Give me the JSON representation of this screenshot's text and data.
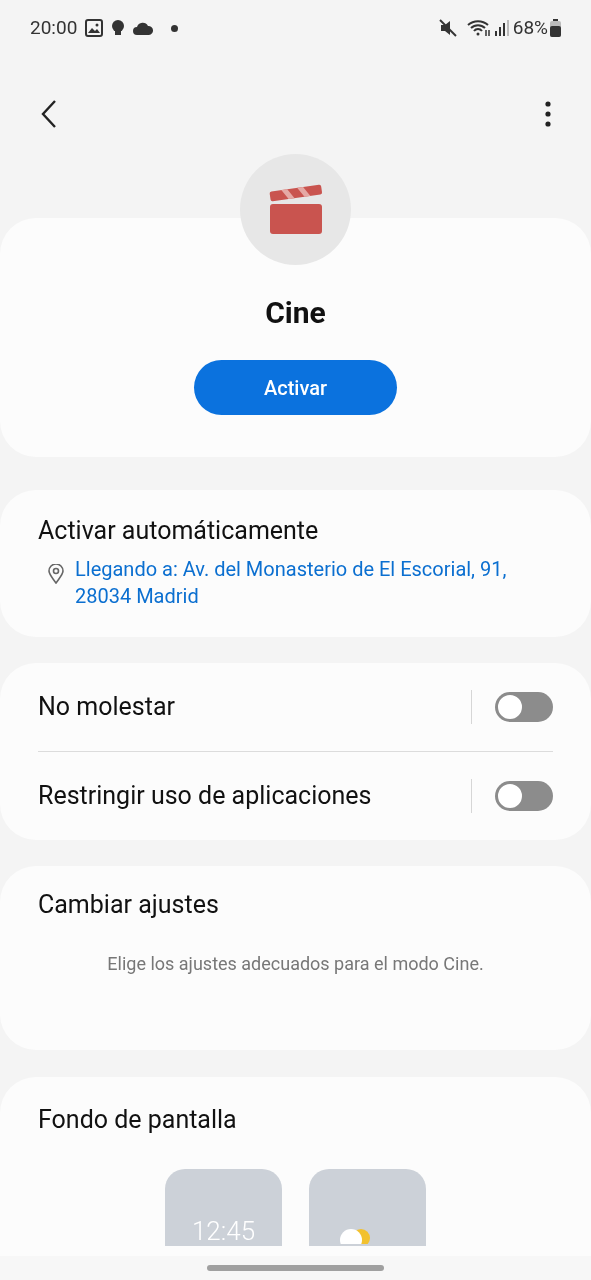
{
  "status_bar": {
    "time": "20:00",
    "battery": "68%"
  },
  "mode": {
    "name": "Cine",
    "button": "Activar"
  },
  "auto_activate": {
    "title": "Activar automáticamente",
    "location": "Llegando a: Av. del Monasterio de El Escorial, 91, 28034 Madrid"
  },
  "toggles": [
    {
      "label": "No molestar",
      "on": false
    },
    {
      "label": "Restringir uso de aplicaciones",
      "on": false
    }
  ],
  "change_settings": {
    "title": "Cambiar ajustes",
    "description": "Elige los ajustes adecuados para el modo Cine."
  },
  "wallpaper": {
    "title": "Fondo de pantalla",
    "previews": [
      {
        "kind": "clock",
        "text": "12:45"
      },
      {
        "kind": "weather"
      }
    ]
  }
}
